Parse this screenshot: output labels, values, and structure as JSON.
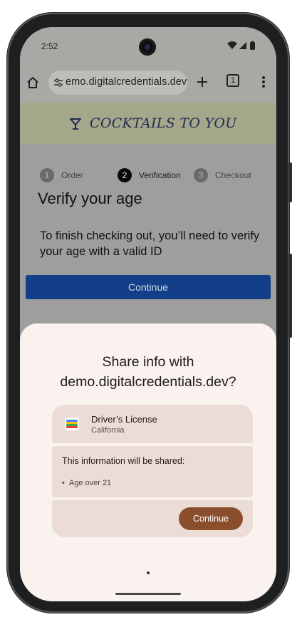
{
  "status_bar": {
    "time": "2:52"
  },
  "browser": {
    "url": "emo.digitalcredentials.dev",
    "tab_count": "1"
  },
  "site": {
    "title": "COCKTAILS TO YOU"
  },
  "steps": [
    {
      "num": "1",
      "label": "Order"
    },
    {
      "num": "2",
      "label": "Verification"
    },
    {
      "num": "3",
      "label": "Checkout"
    }
  ],
  "page": {
    "heading": "Verify your age",
    "text": "To finish checking out, you’ll need to verify your age with a valid ID",
    "continue_label": "Continue"
  },
  "sheet": {
    "title_line1": "Share info with",
    "title_line2": "demo.digitalcredentials.dev?",
    "credential_name": "Driver’s License",
    "credential_region": "California",
    "shared_heading": "This information will be shared:",
    "shared_items": [
      "Age over 21"
    ],
    "continue_label": "Continue"
  },
  "colors": {
    "primary_button": "#123f87",
    "sheet_button": "#8a4e2c",
    "site_header": "#a5a78a",
    "sheet_bg": "#faf2ee"
  }
}
